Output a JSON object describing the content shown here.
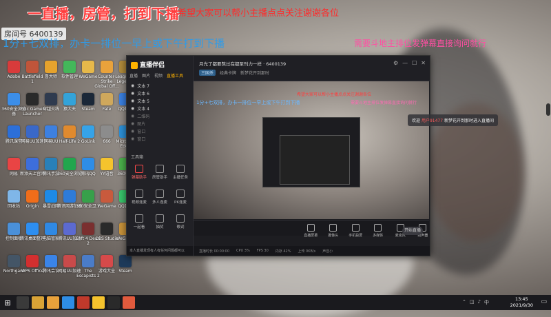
{
  "overlay": {
    "title": "一直播，房管，打到下播",
    "hope": "希望大家可以帮小主播点点关注谢谢各位",
    "room_label": "房间号",
    "room_number": "6400139",
    "blue_line": "1分+七双排，办卡一排位一早上或下午打到下播",
    "pink_line": "需要斗地主排位发弹幕直接询问就行"
  },
  "desktop_icons": [
    {
      "label": "Adobe",
      "color": "#d83b3b"
    },
    {
      "label": "360安全浏览器",
      "color": "#3c8ee8"
    },
    {
      "label": "腾讯课堂",
      "color": "#2c6fd8"
    },
    {
      "label": "网易",
      "color": "#e94444"
    },
    {
      "label": "回收站",
      "color": "#7fb6e8"
    },
    {
      "label": "控制面板",
      "color": "#4a90d9"
    },
    {
      "label": "Northgard",
      "color": "#445566"
    },
    {
      "label": "Battlefield 1",
      "color": "#c0553a"
    },
    {
      "label": "Epic Games Launcher",
      "color": "#2a2a2a"
    },
    {
      "label": "网易UU加速",
      "color": "#3a68c8"
    },
    {
      "label": "新添天上宫网",
      "color": "#3d6edb"
    },
    {
      "label": "Origin",
      "color": "#f06d1a"
    },
    {
      "label": "腾讯桌面整理",
      "color": "#2d8ef0"
    },
    {
      "label": "WPS Office",
      "color": "#d32f2f"
    },
    {
      "label": "鲁大师",
      "color": "#e6a32d"
    },
    {
      "label": "穿越火线",
      "color": "#2f3b4f"
    },
    {
      "label": "网易UU",
      "color": "#3d80e0"
    },
    {
      "label": "腾讯手游",
      "color": "#2980b9"
    },
    {
      "label": "暴雪战网",
      "color": "#1d8ae6"
    },
    {
      "label": "电脑管家",
      "color": "#2f89e4"
    },
    {
      "label": "腾讯会议",
      "color": "#3a84e8"
    },
    {
      "label": "软件管理",
      "color": "#43b75a"
    },
    {
      "label": "猿大夫",
      "color": "#33a3d9"
    },
    {
      "label": "Half-Life 2",
      "color": "#e08a2e"
    },
    {
      "label": "360安全浏览",
      "color": "#22a64d"
    },
    {
      "label": "腾讯网游加速",
      "color": "#2e7bd8"
    },
    {
      "label": "腾讯UU加速",
      "color": "#5c6ad0"
    },
    {
      "label": "网易UU加速",
      "color": "#c94a4a"
    },
    {
      "label": "WeGame",
      "color": "#e6b84a"
    },
    {
      "label": "Steam",
      "color": "#1b2838"
    },
    {
      "label": "GoLink",
      "color": "#36a3e8"
    },
    {
      "label": "腾讯QQ",
      "color": "#2e8de6"
    },
    {
      "label": "360安全卫士",
      "color": "#37a04a"
    },
    {
      "label": "Left 4 Dead 2",
      "color": "#7a2f2f"
    },
    {
      "label": "The Escapists 2",
      "color": "#4a7cc8"
    },
    {
      "label": "Counter-Strike Global Off...",
      "color": "#e9a23b"
    },
    {
      "label": "Fate",
      "color": "#cfa85c"
    },
    {
      "label": "666",
      "color": "#8c8c8c"
    },
    {
      "label": "YY语音",
      "color": "#f5c32d"
    },
    {
      "label": "WeGame",
      "color": "#c85a3d"
    },
    {
      "label": "OBS Studio",
      "color": "#2a2a2a"
    },
    {
      "label": "游戏大全",
      "color": "#d64a4a"
    },
    {
      "label": "League of Legends",
      "color": "#b08a3a"
    },
    {
      "label": "QQ截图",
      "color": "#3a7fe0"
    },
    {
      "label": "Microsoft Edge",
      "color": "#2c8fd6"
    },
    {
      "label": "360极速",
      "color": "#4ab04a"
    },
    {
      "label": "QQ音乐",
      "color": "#38c46a"
    },
    {
      "label": "WeGame",
      "color": "#c9933a"
    },
    {
      "label": "Steam",
      "color": "#1e3a5a"
    }
  ],
  "app": {
    "logo": "直播伴侣",
    "tabs": [
      "直播",
      "图片",
      "视频",
      "直播工具"
    ],
    "scenes": [
      "文本 7",
      "文本 6",
      "文本 5",
      "文本 4",
      "二维码",
      "图片",
      "窗口",
      "窗口"
    ],
    "tools_title": "工具箱",
    "tools": [
      {
        "label": "弹幕助手",
        "on": true
      },
      {
        "label": "房管助手",
        "on": false
      },
      {
        "label": "主播任务",
        "on": false
      },
      {
        "label": "视频连麦",
        "on": false
      },
      {
        "label": "多人连麦",
        "on": false
      },
      {
        "label": "PK连麦",
        "on": false
      },
      {
        "label": "一起看",
        "on": false
      },
      {
        "label": "抽奖",
        "on": false
      },
      {
        "label": "歌词",
        "on": false
      }
    ],
    "stream_title": "月光了都要熬过在都至刊力一样",
    "room_id": "6400139",
    "category_tag": "三国杀",
    "stream_tags": [
      "经典卡牌",
      "新梦花开到那时"
    ],
    "bottom_buttons": [
      "直播屏幕",
      "摄像头",
      "手机投屏",
      "多媒体",
      "麦克风",
      "扬声器"
    ],
    "start_label": "开始直播",
    "status_items": [
      "直播时长 00:00:00",
      "CPU 3%",
      "FPS 30",
      "内存 42%",
      "上传 0KB/s",
      "声音小"
    ],
    "notice": "本人直播发现有人有任何问题都可以"
  },
  "preview": {
    "red1": "希望大家可以帮小主播点点关注谢谢各位",
    "blue1": "1分+七双排，办卡一排位一早上或下午打到下播",
    "pink1": "需要斗地主排位发弹幕直接询问就行"
  },
  "chat": {
    "welcome_prefix": "欢迎",
    "user": "用户91477",
    "welcome_suffix": "新梦花开到那时进入直播间"
  },
  "taskbar": {
    "time": "13:45",
    "date": "2021/9/30",
    "apps": [
      "#3a3a3a",
      "#d9a336",
      "#e9a23b",
      "#2e8de6",
      "#c0392b",
      "#f5c32d",
      "#2a2a2a",
      "#e15a3d"
    ]
  }
}
